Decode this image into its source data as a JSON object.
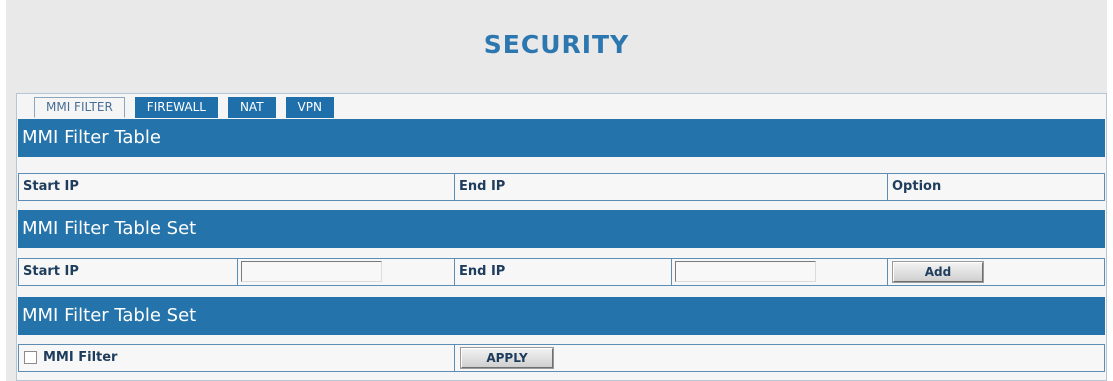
{
  "page": {
    "title": "SECURITY"
  },
  "tabs": [
    {
      "label": "MMI FILTER",
      "active": true
    },
    {
      "label": "FIREWALL",
      "active": false
    },
    {
      "label": "NAT",
      "active": false
    },
    {
      "label": "VPN",
      "active": false
    }
  ],
  "filter_table": {
    "header": "MMI Filter Table",
    "columns": [
      "Start IP",
      "End IP",
      "Option"
    ]
  },
  "filter_set": {
    "header": "MMI Filter Table Set",
    "start_ip_label": "Start IP",
    "start_ip_value": "",
    "end_ip_label": "End IP",
    "end_ip_value": "",
    "add_button": "Add"
  },
  "filter_enable": {
    "header": "MMI Filter Table Set",
    "checkbox_label": "MMI Filter",
    "checked": false,
    "apply_button": "APPLY"
  },
  "colors": {
    "accent": "#2473ab",
    "title": "#2c77b0",
    "background": "#e9e9e9"
  }
}
